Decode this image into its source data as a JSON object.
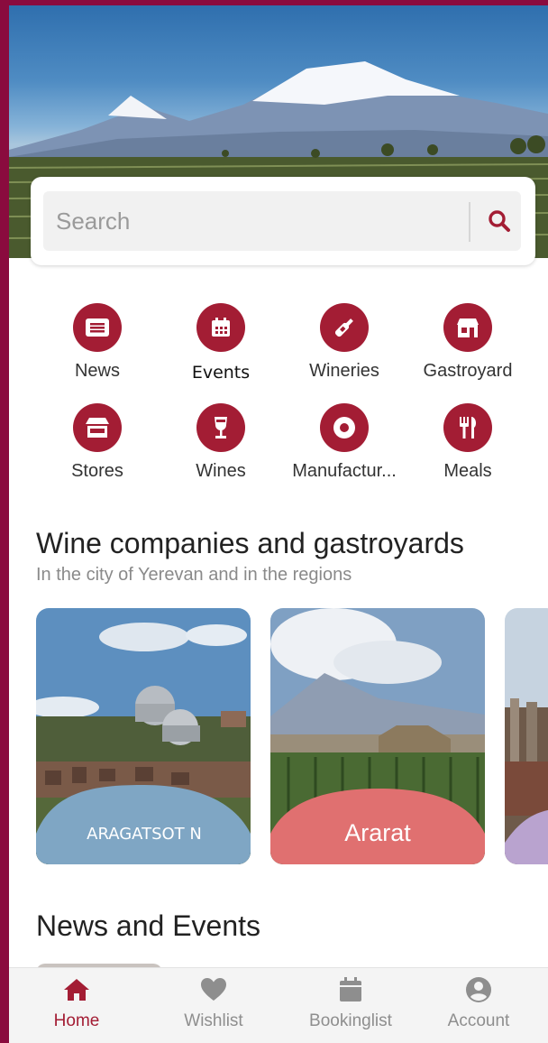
{
  "search": {
    "placeholder": "Search"
  },
  "categories": [
    {
      "label": "News",
      "icon": "news-icon"
    },
    {
      "label": "Events",
      "icon": "calendar-icon"
    },
    {
      "label": "Wineries",
      "icon": "wine-bottle-icon"
    },
    {
      "label": "Gastroyard",
      "icon": "gastroyard-icon"
    },
    {
      "label": "Stores",
      "icon": "store-icon"
    },
    {
      "label": "Wines",
      "icon": "wine-glass-icon"
    },
    {
      "label": "Manufactur...",
      "icon": "target-icon"
    },
    {
      "label": "Meals",
      "icon": "fork-knife-icon"
    }
  ],
  "wine_section": {
    "title": "Wine companies and gastroyards",
    "subtitle": "In the city of Yerevan and in the regions"
  },
  "regions": [
    {
      "label": "ARAGATSOT N",
      "color": "#7fa6c4"
    },
    {
      "label": "Ararat",
      "color": "#e07070"
    },
    {
      "label": "",
      "color": "#b9a3cf"
    }
  ],
  "news_section": {
    "title": "News and Events"
  },
  "bottom_nav": [
    {
      "label": "Home",
      "icon": "home-icon",
      "active": true
    },
    {
      "label": "Wishlist",
      "icon": "heart-icon",
      "active": false
    },
    {
      "label": "Bookinglist",
      "icon": "calendar-icon",
      "active": false
    },
    {
      "label": "Account",
      "icon": "user-icon",
      "active": false
    }
  ],
  "colors": {
    "brand": "#a31d34",
    "frame": "#8a0b3e"
  }
}
